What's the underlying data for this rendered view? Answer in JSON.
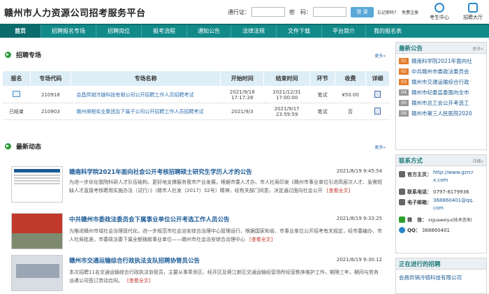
{
  "header": {
    "title": "赣州市人力资源公司招考服务平台",
    "login": {
      "pass_label": "通行证：",
      "pwd_label": "密　码：",
      "login_button": "登 录",
      "forgot": "忘记密码？",
      "register": "免费注册"
    },
    "icons": [
      {
        "label": "考生中心"
      },
      {
        "label": "招聘大厅"
      }
    ]
  },
  "nav": [
    "首页",
    "招聘报名专场",
    "招聘岗位",
    "报考流程",
    "通知公告",
    "法律法规",
    "文件下载",
    "平台简介",
    "我的报名表"
  ],
  "recruit": {
    "title": "招聘专场",
    "more": "更多»",
    "headers": [
      "报名",
      "专场代码",
      "专场名称",
      "开始时间",
      "结束时间",
      "环节",
      "收费",
      "详细"
    ],
    "rows": [
      {
        "status": "",
        "code": "210918",
        "name": "会昌供销冷链科技有限公司公开招聘工作人员招聘考试",
        "start": "2021/9/18 17:17:28",
        "end": "2021/12/31 17:00:00",
        "stage": "笔试",
        "fee": "¥50.00"
      },
      {
        "status": "已结束",
        "code": "210903",
        "name": "赣州保税实业集团及下属子公司公开招聘工作人员招聘考试",
        "start": "2021/9/3",
        "end": "2021/9/17 23:59:59",
        "stage": "笔试",
        "fee": "否"
      }
    ]
  },
  "news": {
    "title": "最新动态",
    "more": "更多»",
    "read_more": "[查看全文]",
    "items": [
      {
        "title": "赣南科学院2021年面向社会公开考核招聘硕士研究生学历人才的公告",
        "date": "2021/8/19 9:45:54",
        "desc": "为进一步优化我院科研人才队伍结构，更好地支撑服务我市产业发展，根据市委人才办、市人社局印发《赣州市事业单位引进高层次人才、急需短缺人才直接考核聘用实施办法（试行）》（赣市人社发〔2017〕32号）精神，经有关部门同意，决定通过面向社会公开"
      },
      {
        "title": "中共赣州市委政法委员会下属事业单位公开考选工作人员公告",
        "date": "2021/8/19 9:33:25",
        "desc": "为推进赣州市域社会治理现代化，进一步规范市社会治安综合治理中心管理运行，根据国家和省、市事业单位公开招考有关规定，经市委编办、市人社局批准，市委政法委下属全额拨款事业单位——赣州市社会治安综合治理中心"
      },
      {
        "title": "赣州市交通运输综合行政执法支队招聘协管员公告",
        "date": "2021/8/19 9:30:12",
        "desc": "本次招聘11名交通运输综合行政执法协管员，主要从事章贡区、经开区及蓉江新区交通运输经营场所经营秩序维护工作，期限三年，期间与劳务派遣公司签订劳动合同。"
      }
    ]
  },
  "sidebar": {
    "notice": {
      "title": "最新公告",
      "more": "更多»",
      "items": [
        {
          "num": "01",
          "text": "赣南科学院2021年面向社"
        },
        {
          "num": "02",
          "text": "中共赣州市委政法委员会"
        },
        {
          "num": "03",
          "text": "赣州市交通运输综合行政"
        },
        {
          "num": "04",
          "text": "赣州市纪委监委面向全市"
        },
        {
          "num": "05",
          "text": "赣州市总工会公开考选工"
        },
        {
          "num": "06",
          "text": "赣州市第三人民医院2020"
        }
      ]
    },
    "contact": {
      "title": "联系方式",
      "more": "详细»",
      "site_label": "官方主页：",
      "site": "http://www.gzrcrx.com",
      "phone_label": "联系电话：",
      "phone": "0797-8179936",
      "email_label": "电子邮箱：",
      "email": "368860401@qq.com",
      "wechat_label": "微　信：",
      "wechat": "xiguaweiyu(技术咨询)",
      "qq_label": "QQ：",
      "qq": "368860401"
    },
    "ongoing": {
      "title": "正在进行的招聘",
      "item": "会昌供销冷链科技有限公司"
    }
  }
}
